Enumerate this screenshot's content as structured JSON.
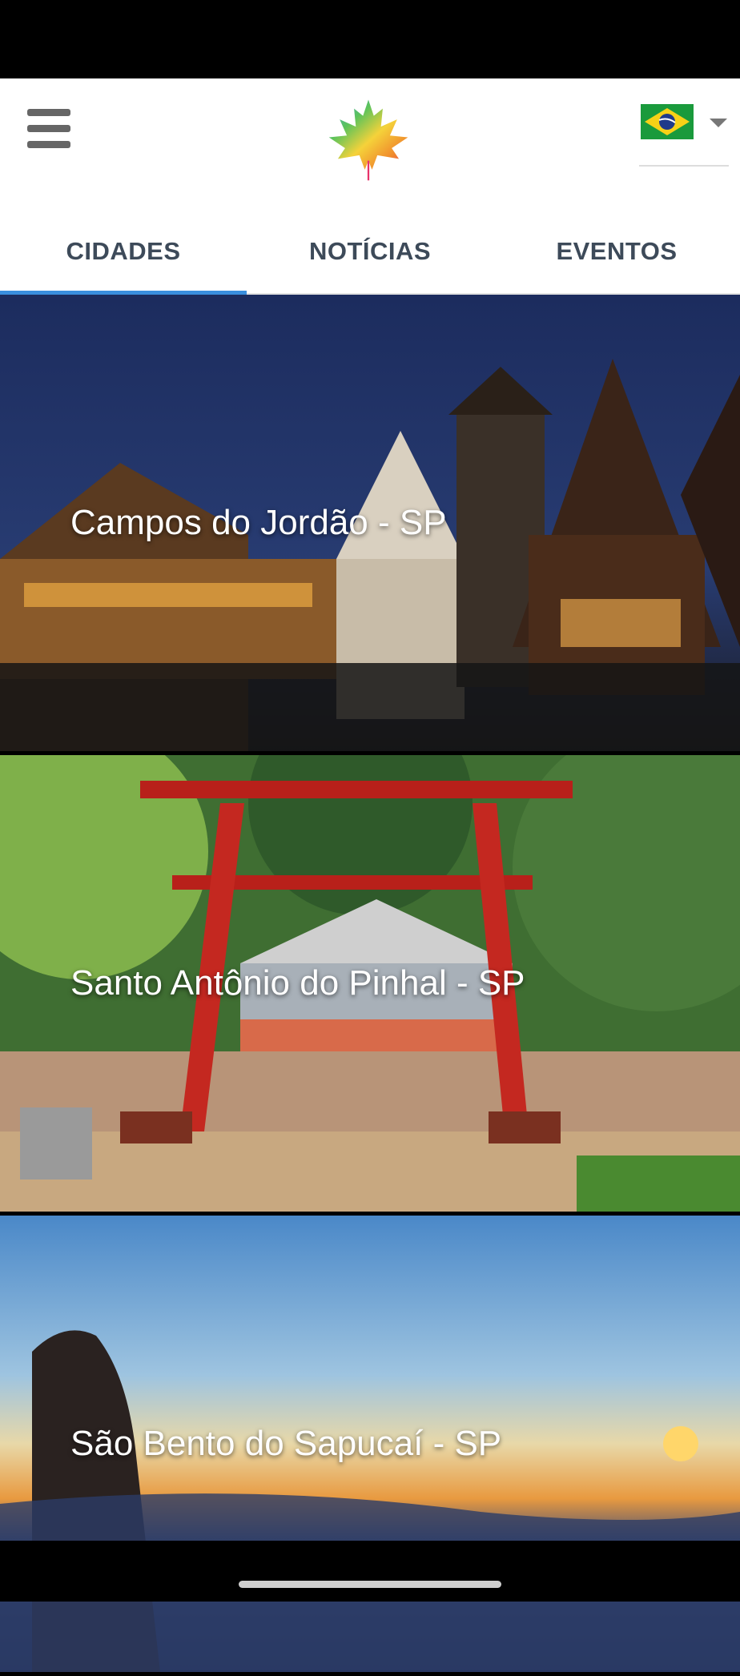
{
  "app": {
    "logo_icon": "maple-leaf-logo",
    "language_flag": "brazil-flag"
  },
  "tabs": [
    {
      "label": "CIDADES",
      "active": true
    },
    {
      "label": "NOTÍCIAS",
      "active": false
    },
    {
      "label": "EVENTOS",
      "active": false
    }
  ],
  "cities": [
    {
      "name": "Campos do Jordão - SP"
    },
    {
      "name": "Santo Antônio do Pinhal - SP"
    },
    {
      "name": "São Bento do Sapucaí - SP"
    }
  ],
  "colors": {
    "accent": "#3a8fde",
    "tab_text": "#3d4a59"
  }
}
